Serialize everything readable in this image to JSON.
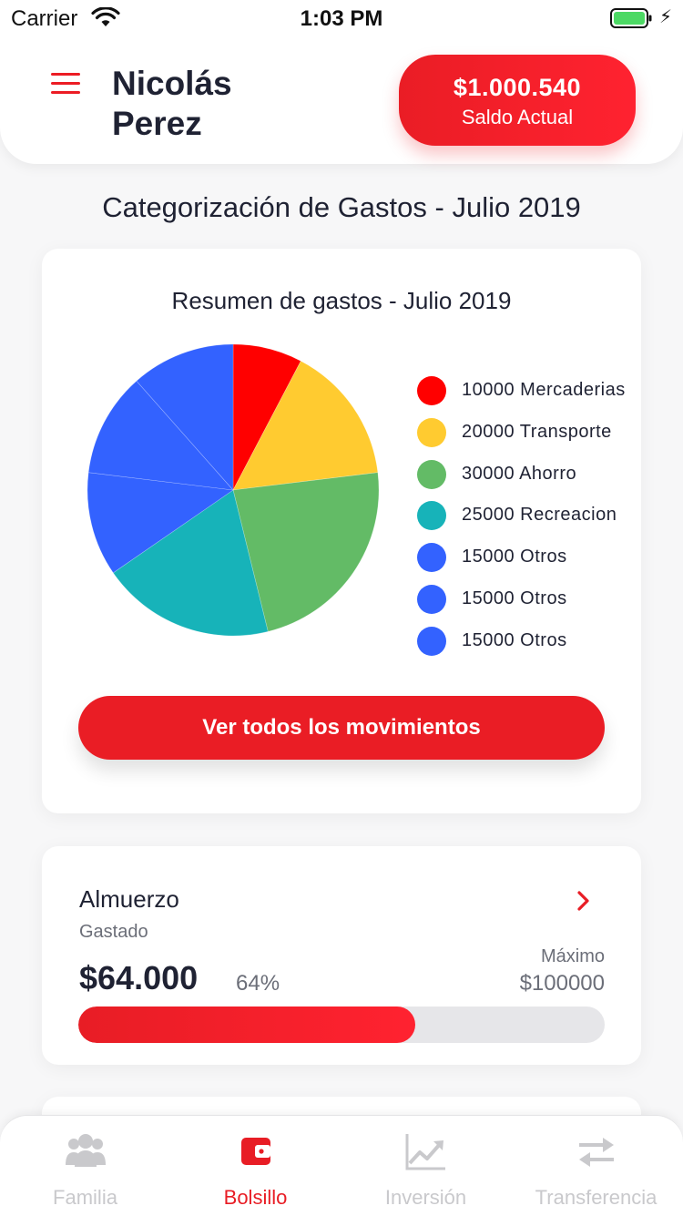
{
  "status_bar": {
    "carrier": "Carrier",
    "time": "1:03 PM"
  },
  "header": {
    "user_name": "Nicolás Perez",
    "balance": "$1.000.540",
    "balance_label": "Saldo Actual",
    "accent_color": "#ec1c24"
  },
  "section_title": "Categorización de Gastos - Julio 2019",
  "chart_card": {
    "button_label": "Ver todos los movimientos"
  },
  "chart_data": {
    "type": "pie",
    "title": "Resumen de gastos - Julio 2019",
    "slices": [
      {
        "label": "10000 Mercaderias",
        "value": 10000,
        "color": "#ff0000"
      },
      {
        "label": "20000 Transporte",
        "value": 20000,
        "color": "#ffcb30"
      },
      {
        "label": "30000 Ahorro",
        "value": 30000,
        "color": "#63bb66"
      },
      {
        "label": "25000 Recreacion",
        "value": 25000,
        "color": "#17b3b9"
      },
      {
        "label": "15000 Otros",
        "value": 15000,
        "color": "#3362ff"
      },
      {
        "label": "15000 Otros",
        "value": 15000,
        "color": "#3362ff"
      },
      {
        "label": "15000 Otros",
        "value": 15000,
        "color": "#3362ff"
      }
    ],
    "legend_position": "right"
  },
  "expense": {
    "name": "Almuerzo",
    "sublabel": "Gastado",
    "amount": "$64.000",
    "percent_label": "64%",
    "progress": 0.64,
    "max_label": "Máximo",
    "max_value": "$100000"
  },
  "tab_bar": {
    "tabs": [
      {
        "label": "Familia",
        "icon": "family-icon",
        "active": false
      },
      {
        "label": "Bolsillo",
        "icon": "wallet-icon",
        "active": true
      },
      {
        "label": "Inversión",
        "icon": "chart-line-icon",
        "active": false
      },
      {
        "label": "Transferencia",
        "icon": "transfer-icon",
        "active": false
      }
    ]
  }
}
